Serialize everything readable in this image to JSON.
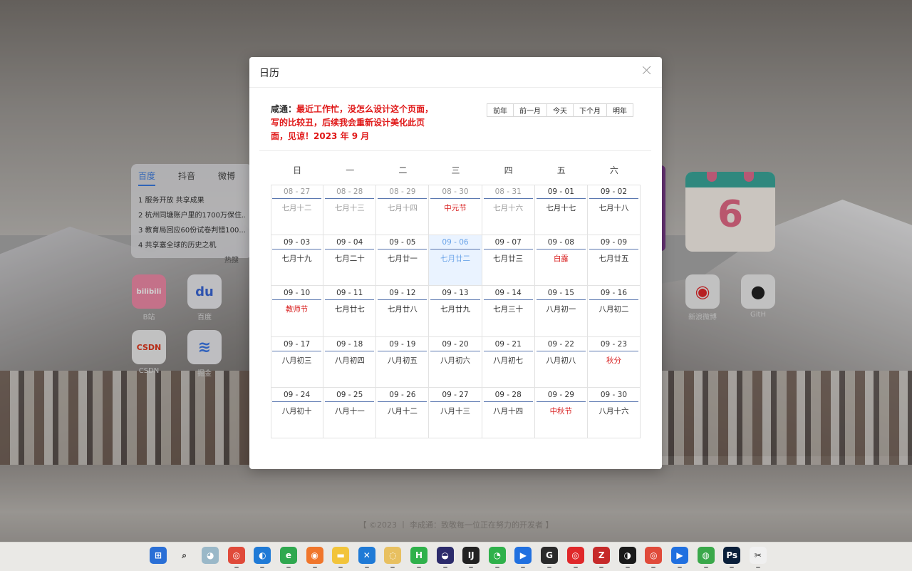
{
  "desktop": {
    "hot_tabs": [
      "百度",
      "抖音",
      "微博"
    ],
    "hot_list": [
      "1 服务开放 共享成果",
      "2 杭州同塘账户里的1700万保住...",
      "3 教育局回应60份试卷判错100...",
      "4 共享塞全球的历史之机"
    ],
    "hot_more": "热搜",
    "apps": [
      {
        "name": "B站",
        "glyph": "bilibili",
        "color": "#f08aa8"
      },
      {
        "name": "百度",
        "glyph": "du",
        "color": "#3a67d6"
      },
      {
        "name": "CSDN",
        "glyph": "CSDN",
        "color": "#e8e8e8"
      },
      {
        "name": "掘金",
        "glyph": "≋",
        "color": "#3b78e7"
      },
      {
        "name": "新浪微博",
        "glyph": "◉",
        "color": "#e8e8e8"
      },
      {
        "name": "GitH",
        "glyph": "●",
        "color": "#e8e8e8"
      }
    ],
    "calendar_widget_day": "6",
    "footer": "【 ©2023 丨 李成通：致敬每一位正在努力的开发者 】"
  },
  "modal": {
    "title": "日历",
    "note_author": "咸通：",
    "note_text": "最近工作忙，没怎么设计这个页面，写的比较丑，后续我会重新设计美化此页面，见谅！2023 年 9 月",
    "nav": [
      "前年",
      "前一月",
      "今天",
      "下个月",
      "明年"
    ],
    "weekdays": [
      "日",
      "一",
      "二",
      "三",
      "四",
      "五",
      "六"
    ]
  },
  "calendar": {
    "weeks": [
      [
        {
          "date": "08 - 27",
          "lunar": "七月十二",
          "other": true
        },
        {
          "date": "08 - 28",
          "lunar": "七月十三",
          "other": true
        },
        {
          "date": "08 - 29",
          "lunar": "七月十四",
          "other": true
        },
        {
          "date": "08 - 30",
          "lunar": "中元节",
          "other": true,
          "festival": true
        },
        {
          "date": "08 - 31",
          "lunar": "七月十六",
          "other": true
        },
        {
          "date": "09 - 01",
          "lunar": "七月十七"
        },
        {
          "date": "09 - 02",
          "lunar": "七月十八"
        }
      ],
      [
        {
          "date": "09 - 03",
          "lunar": "七月十九"
        },
        {
          "date": "09 - 04",
          "lunar": "七月二十"
        },
        {
          "date": "09 - 05",
          "lunar": "七月廿一"
        },
        {
          "date": "09 - 06",
          "lunar": "七月廿二",
          "today": true
        },
        {
          "date": "09 - 07",
          "lunar": "七月廿三"
        },
        {
          "date": "09 - 08",
          "lunar": "白露",
          "festival": true
        },
        {
          "date": "09 - 09",
          "lunar": "七月廿五"
        }
      ],
      [
        {
          "date": "09 - 10",
          "lunar": "教师节",
          "festival": true
        },
        {
          "date": "09 - 11",
          "lunar": "七月廿七"
        },
        {
          "date": "09 - 12",
          "lunar": "七月廿八"
        },
        {
          "date": "09 - 13",
          "lunar": "七月廿九"
        },
        {
          "date": "09 - 14",
          "lunar": "七月三十"
        },
        {
          "date": "09 - 15",
          "lunar": "八月初一"
        },
        {
          "date": "09 - 16",
          "lunar": "八月初二"
        }
      ],
      [
        {
          "date": "09 - 17",
          "lunar": "八月初三"
        },
        {
          "date": "09 - 18",
          "lunar": "八月初四"
        },
        {
          "date": "09 - 19",
          "lunar": "八月初五"
        },
        {
          "date": "09 - 20",
          "lunar": "八月初六"
        },
        {
          "date": "09 - 21",
          "lunar": "八月初七"
        },
        {
          "date": "09 - 22",
          "lunar": "八月初八"
        },
        {
          "date": "09 - 23",
          "lunar": "秋分",
          "festival": true
        }
      ],
      [
        {
          "date": "09 - 24",
          "lunar": "八月初十"
        },
        {
          "date": "09 - 25",
          "lunar": "八月十一"
        },
        {
          "date": "09 - 26",
          "lunar": "八月十二"
        },
        {
          "date": "09 - 27",
          "lunar": "八月十三"
        },
        {
          "date": "09 - 28",
          "lunar": "八月十四"
        },
        {
          "date": "09 - 29",
          "lunar": "中秋节",
          "festival": true
        },
        {
          "date": "09 - 30",
          "lunar": "八月十六"
        }
      ]
    ]
  },
  "taskbar": {
    "icons": [
      {
        "name": "windows-start-icon",
        "glyph": "⊞",
        "color": "#2a6fd6"
      },
      {
        "name": "search-icon",
        "glyph": "⌕",
        "color": "#333333"
      },
      {
        "name": "chat-icon",
        "glyph": "◕",
        "color": "#9ab8c8"
      },
      {
        "name": "chrome-icon",
        "glyph": "◎",
        "color": "#e04a3a"
      },
      {
        "name": "edge-icon",
        "glyph": "◐",
        "color": "#1f7ad6"
      },
      {
        "name": "edge-beta-icon",
        "glyph": "e",
        "color": "#2fa84f"
      },
      {
        "name": "firefox-icon",
        "glyph": "◉",
        "color": "#f0762b"
      },
      {
        "name": "file-explorer-icon",
        "glyph": "▬",
        "color": "#f2c43a"
      },
      {
        "name": "vscode-icon",
        "glyph": "✕",
        "color": "#1f7ad6"
      },
      {
        "name": "snipaste-icon",
        "glyph": "◌",
        "color": "#e8c060"
      },
      {
        "name": "hbuilder-icon",
        "glyph": "H",
        "color": "#2fb14b"
      },
      {
        "name": "eclipse-icon",
        "glyph": "◒",
        "color": "#2c2b6b"
      },
      {
        "name": "intellij-icon",
        "glyph": "IJ",
        "color": "#222222"
      },
      {
        "name": "wechat-icon",
        "glyph": "◔",
        "color": "#2fb14b"
      },
      {
        "name": "feishu-icon",
        "glyph": "▶",
        "color": "#2070e0"
      },
      {
        "name": "logo-g-icon",
        "glyph": "G",
        "color": "#2a2a2a"
      },
      {
        "name": "netease-music-icon",
        "glyph": "◎",
        "color": "#e0282a"
      },
      {
        "name": "filezilla-icon",
        "glyph": "Z",
        "color": "#c62a2a"
      },
      {
        "name": "qq-icon",
        "glyph": "◑",
        "color": "#1a1a1a"
      },
      {
        "name": "chrome-icon-2",
        "glyph": "◎",
        "color": "#e04a3a"
      },
      {
        "name": "feishu-icon-2",
        "glyph": "▶",
        "color": "#2070e0"
      },
      {
        "name": "green-app-icon",
        "glyph": "◍",
        "color": "#3aa84a"
      },
      {
        "name": "photoshop-icon",
        "glyph": "Ps",
        "color": "#0a1f3a"
      },
      {
        "name": "snipping-tool-icon",
        "glyph": "✂",
        "color": "#f0f0f0"
      }
    ]
  }
}
